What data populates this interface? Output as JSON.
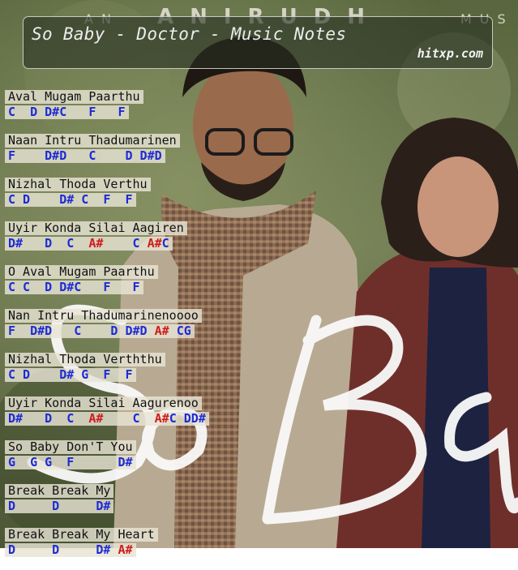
{
  "banner": {
    "brand_left": "AN",
    "brand_main": "ANIRUDH",
    "brand_right": "MUS",
    "poster_script": "So Baby"
  },
  "header": {
    "title": "So Baby - Doctor - Music Notes",
    "site": "hitxp.com"
  },
  "lines": [
    {
      "lyric": "Aval Mugam Paarthu",
      "notes": "C  D D#C   F   F"
    },
    {
      "lyric": "Naan Intru Thadumarinen",
      "notes": "F    D#D   C    D D#D"
    },
    {
      "lyric": "Nizhal Thoda Verthu",
      "notes": "C D    D# C  F  F"
    },
    {
      "lyric": "Uyir Konda Silai Aagiren",
      "notes": "D#   D  C  A#    C A#C"
    },
    {
      "lyric": "O Aval Mugam Paarthu",
      "notes": "C C  D D#C   F   F"
    },
    {
      "lyric": "Nan Intru Thadumarinenoooo",
      "notes": "F  D#D   C    D D#D A# CG"
    },
    {
      "lyric": "Nizhal Thoda Verththu",
      "notes": "C D    D# G  F  F"
    },
    {
      "lyric": "Uyir Konda Silai Aagurenoo",
      "notes": "D#   D  C  A#    C  A#C DD#"
    },
    {
      "lyric": "So Baby Don'T You",
      "notes": "G  G G  F      D#"
    },
    {
      "lyric": "Break Break My",
      "notes": "D     D     D#"
    },
    {
      "lyric": "Break Break My Heart",
      "notes": "D     D     D# A#"
    }
  ]
}
